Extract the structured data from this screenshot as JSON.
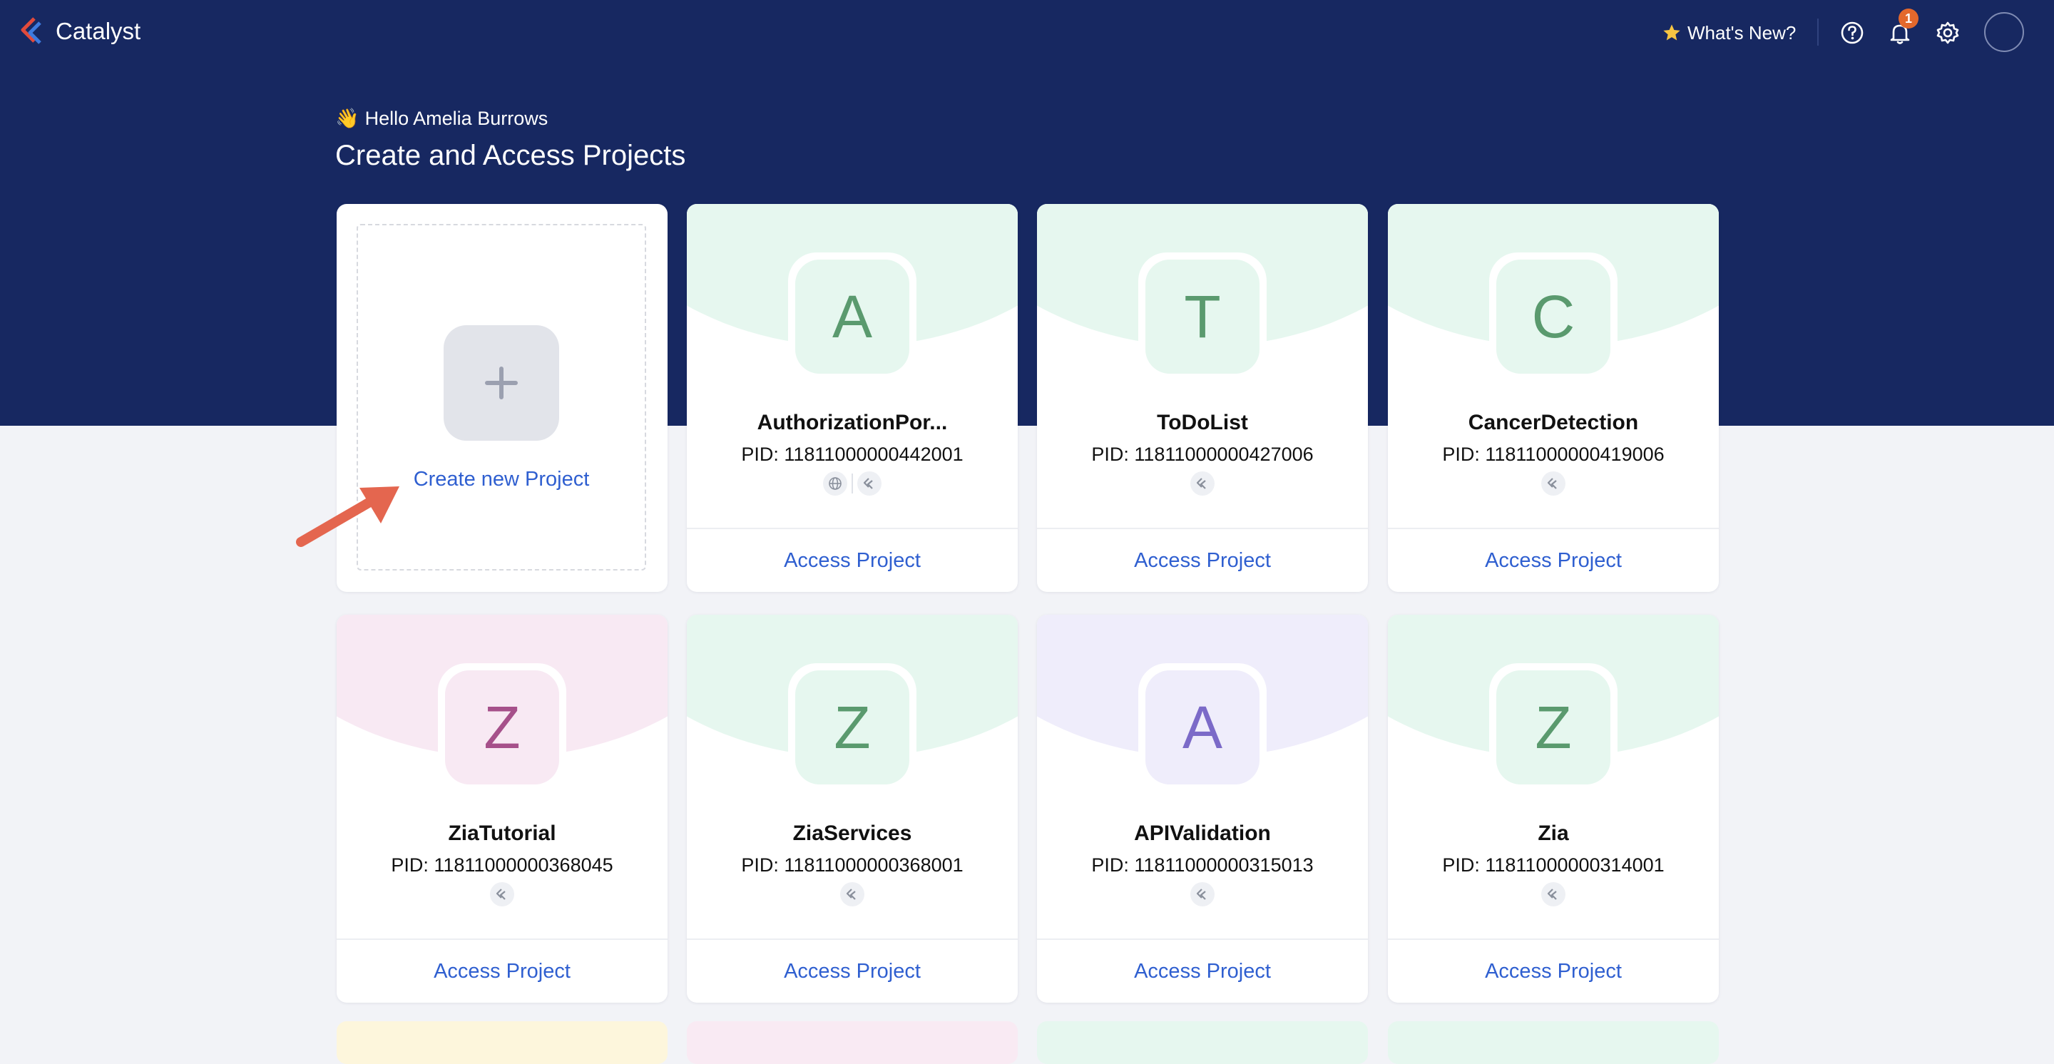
{
  "app": {
    "brand": "Catalyst"
  },
  "topbar": {
    "whats_new": "What's New?",
    "notification_count": "1",
    "icons": [
      "star-icon",
      "help-icon",
      "bell-icon",
      "gear-icon",
      "avatar"
    ]
  },
  "header": {
    "greeting": "Hello Amelia Burrows",
    "title": "Create and Access Projects"
  },
  "create_card": {
    "label": "Create new Project"
  },
  "projects": [
    {
      "initial": "A",
      "name": "AuthorizationPor...",
      "pid": "PID: 11811000000442001",
      "color": "#5a9a6e",
      "bg": "#e6f7ef",
      "badges": [
        "globe-icon",
        "catalyst-icon"
      ],
      "access_label": "Access Project"
    },
    {
      "initial": "T",
      "name": "ToDoList",
      "pid": "PID: 11811000000427006",
      "color": "#5a9a6e",
      "bg": "#e6f7ef",
      "badges": [
        "catalyst-icon"
      ],
      "access_label": "Access Project"
    },
    {
      "initial": "C",
      "name": "CancerDetection",
      "pid": "PID: 11811000000419006",
      "color": "#5a9a6e",
      "bg": "#e6f7ef",
      "badges": [
        "catalyst-icon"
      ],
      "access_label": "Access Project"
    },
    {
      "initial": "Z",
      "name": "ZiaTutorial",
      "pid": "PID: 11811000000368045",
      "color": "#a6508a",
      "bg": "#f8e9f3",
      "badges": [
        "catalyst-icon"
      ],
      "access_label": "Access Project"
    },
    {
      "initial": "Z",
      "name": "ZiaServices",
      "pid": "PID: 11811000000368001",
      "color": "#5a9a6e",
      "bg": "#e6f7ef",
      "badges": [
        "catalyst-icon"
      ],
      "access_label": "Access Project"
    },
    {
      "initial": "A",
      "name": "APIValidation",
      "pid": "PID: 11811000000315013",
      "color": "#7b6ac8",
      "bg": "#efedfb",
      "badges": [
        "catalyst-icon"
      ],
      "access_label": "Access Project"
    },
    {
      "initial": "Z",
      "name": "Zia",
      "pid": "PID: 11811000000314001",
      "color": "#5a9a6e",
      "bg": "#e6f7ef",
      "badges": [
        "catalyst-icon"
      ],
      "access_label": "Access Project"
    }
  ],
  "partial_row_colors": [
    "#fdf6dc",
    "#f9eaf3",
    "#e6f7ef",
    "#e6f7ef"
  ],
  "colors": {
    "header_bg": "#172861",
    "page_bg": "#f2f3f7",
    "link": "#2f5fd0",
    "badge": "#e3682c",
    "arrow": "#e4664f"
  }
}
